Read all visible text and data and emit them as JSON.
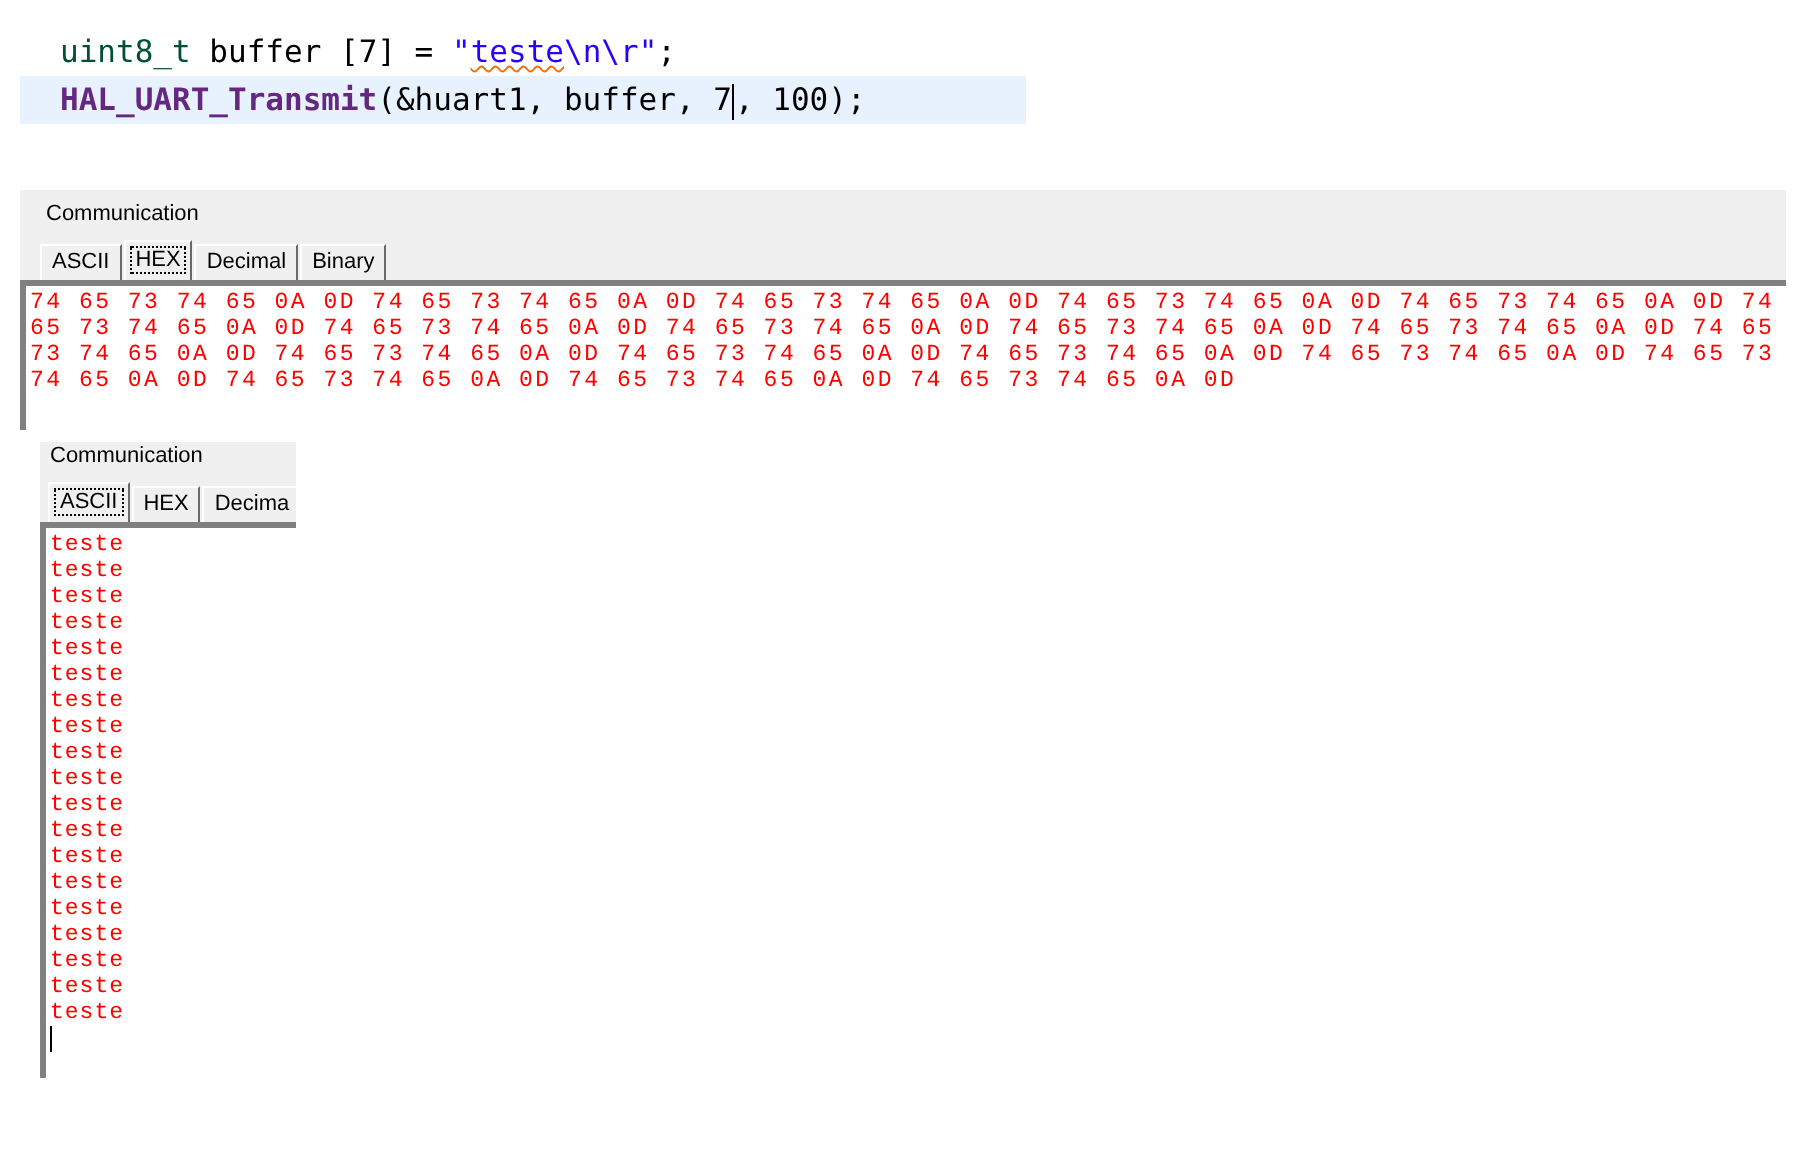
{
  "code_editor": {
    "lines": [
      {
        "current": false,
        "segments": [
          {
            "kind": "type",
            "text": "uint8_t"
          },
          {
            "kind": "plain",
            "text": " buffer [7] = "
          },
          {
            "kind": "string",
            "text": "\""
          },
          {
            "kind": "misspelled",
            "text": "teste"
          },
          {
            "kind": "string",
            "text": "\\n\\r\""
          },
          {
            "kind": "plain",
            "text": ";"
          }
        ]
      },
      {
        "current": true,
        "segments": [
          {
            "kind": "function",
            "text": "HAL_UART_Transmit"
          },
          {
            "kind": "plain",
            "text": "(&huart1, buffer, 7"
          },
          {
            "kind": "cursor"
          },
          {
            "kind": "plain",
            "text": ", 100);"
          }
        ]
      }
    ]
  },
  "panels": [
    {
      "title": "Communication",
      "tabs": [
        {
          "label": "ASCII",
          "selected": false
        },
        {
          "label": "HEX",
          "selected": true
        },
        {
          "label": "Decimal",
          "selected": false
        },
        {
          "label": "Binary",
          "selected": false
        }
      ],
      "lines": [
        "74 65 73 74 65 0A 0D 74 65 73 74 65 0A 0D 74 65 73 74 65 0A 0D 74 65 73 74 65 0A 0D 74 65 73 74 65 0A 0D 74",
        "65 73 74 65 0A 0D 74 65 73 74 65 0A 0D 74 65 73 74 65 0A 0D 74 65 73 74 65 0A 0D 74 65 73 74 65 0A 0D 74 65",
        "73 74 65 0A 0D 74 65 73 74 65 0A 0D 74 65 73 74 65 0A 0D 74 65 73 74 65 0A 0D 74 65 73 74 65 0A 0D 74 65 73",
        "74 65 0A 0D 74 65 73 74 65 0A 0D 74 65 73 74 65 0A 0D 74 65 73 74 65 0A 0D"
      ],
      "cursor": false
    },
    {
      "title": "Communication",
      "tabs": [
        {
          "label": "ASCII",
          "selected": true
        },
        {
          "label": "HEX",
          "selected": false
        },
        {
          "label": "Decima",
          "selected": false
        }
      ],
      "lines": [
        "teste",
        "teste",
        "teste",
        "teste",
        "teste",
        "teste",
        "teste",
        "teste",
        "teste",
        "teste",
        "teste",
        "teste",
        "teste",
        "teste",
        "teste",
        "teste",
        "teste",
        "teste",
        "teste"
      ],
      "cursor": true
    }
  ]
}
